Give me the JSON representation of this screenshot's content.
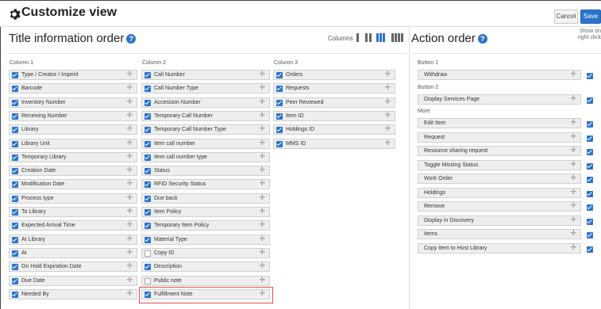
{
  "header": {
    "title": "Customize view",
    "cancel_label": "Cancel",
    "save_label": "Save"
  },
  "title_section": {
    "heading": "Title information order",
    "help_glyph": "?",
    "columns_label": "Columns",
    "selected_columns": 3,
    "column_labels": [
      "Column 1",
      "Column 2",
      "Column 3"
    ],
    "columns": [
      [
        {
          "label": "Type / Creator / Imprint",
          "checked": true
        },
        {
          "label": "Barcode",
          "checked": true
        },
        {
          "label": "Inventory Number",
          "checked": true
        },
        {
          "label": "Receiving Number",
          "checked": true
        },
        {
          "label": "Library",
          "checked": true
        },
        {
          "label": "Library Unit",
          "checked": true
        },
        {
          "label": "Temporary Library",
          "checked": true
        },
        {
          "label": "Creation Date",
          "checked": true
        },
        {
          "label": "Modification Date",
          "checked": true
        },
        {
          "label": "Process type",
          "checked": true
        },
        {
          "label": "To Library",
          "checked": true
        },
        {
          "label": "Expected Arrival Time",
          "checked": true
        },
        {
          "label": "At Library",
          "checked": true
        },
        {
          "label": "At",
          "checked": true
        },
        {
          "label": "On Hold Expiration Date",
          "checked": true
        },
        {
          "label": "Due Date",
          "checked": true
        },
        {
          "label": "Needed By",
          "checked": true
        }
      ],
      [
        {
          "label": "Call Number",
          "checked": true
        },
        {
          "label": "Call Number Type",
          "checked": true
        },
        {
          "label": "Accession Number",
          "checked": true
        },
        {
          "label": "Temporary Call Number",
          "checked": true
        },
        {
          "label": "Temporary Call Number Type",
          "checked": true
        },
        {
          "label": "Item call number",
          "checked": true
        },
        {
          "label": "Item call number type",
          "checked": true
        },
        {
          "label": "Status",
          "checked": true
        },
        {
          "label": "RFID Security Status",
          "checked": true
        },
        {
          "label": "Due back",
          "checked": true
        },
        {
          "label": "Item Policy",
          "checked": true
        },
        {
          "label": "Temporary Item Policy",
          "checked": true
        },
        {
          "label": "Material Type",
          "checked": true
        },
        {
          "label": "Copy ID",
          "checked": false
        },
        {
          "label": "Description",
          "checked": true
        },
        {
          "label": "Public note",
          "checked": false
        },
        {
          "label": "Fulfillment Note",
          "checked": true
        }
      ],
      [
        {
          "label": "Orders",
          "checked": true
        },
        {
          "label": "Requests",
          "checked": true
        },
        {
          "label": "Peer Reviewed",
          "checked": true
        },
        {
          "label": "Item ID",
          "checked": true
        },
        {
          "label": "Holdings ID",
          "checked": true
        },
        {
          "label": "MMS ID",
          "checked": true
        }
      ]
    ]
  },
  "action_section": {
    "heading": "Action order",
    "help_glyph": "?",
    "show_on_right_click_label": "Show on right click",
    "groups": [
      {
        "label": "Button 1",
        "items": [
          {
            "label": "Withdraw",
            "checked": true
          }
        ]
      },
      {
        "label": "Button 2",
        "items": [
          {
            "label": "Display Services Page",
            "checked": true
          }
        ]
      },
      {
        "label": "More",
        "items": [
          {
            "label": "Edit Item",
            "checked": true
          },
          {
            "label": "Request",
            "checked": true
          },
          {
            "label": "Resource sharing request",
            "checked": true
          },
          {
            "label": "Toggle Missing Status",
            "checked": true
          },
          {
            "label": "Work Order",
            "checked": true
          },
          {
            "label": "Holdings",
            "checked": true
          },
          {
            "label": "Remove",
            "checked": true
          },
          {
            "label": "Display in Discovery",
            "checked": true
          },
          {
            "label": "Items",
            "checked": true
          },
          {
            "label": "Copy Item to Host Library",
            "checked": true
          }
        ]
      }
    ]
  },
  "icons": {
    "gear": "gear-icon",
    "drag": "drag-handle-icon",
    "help": "help-icon"
  },
  "colors": {
    "accent": "#2b73cc",
    "highlight_border": "#e05050"
  }
}
